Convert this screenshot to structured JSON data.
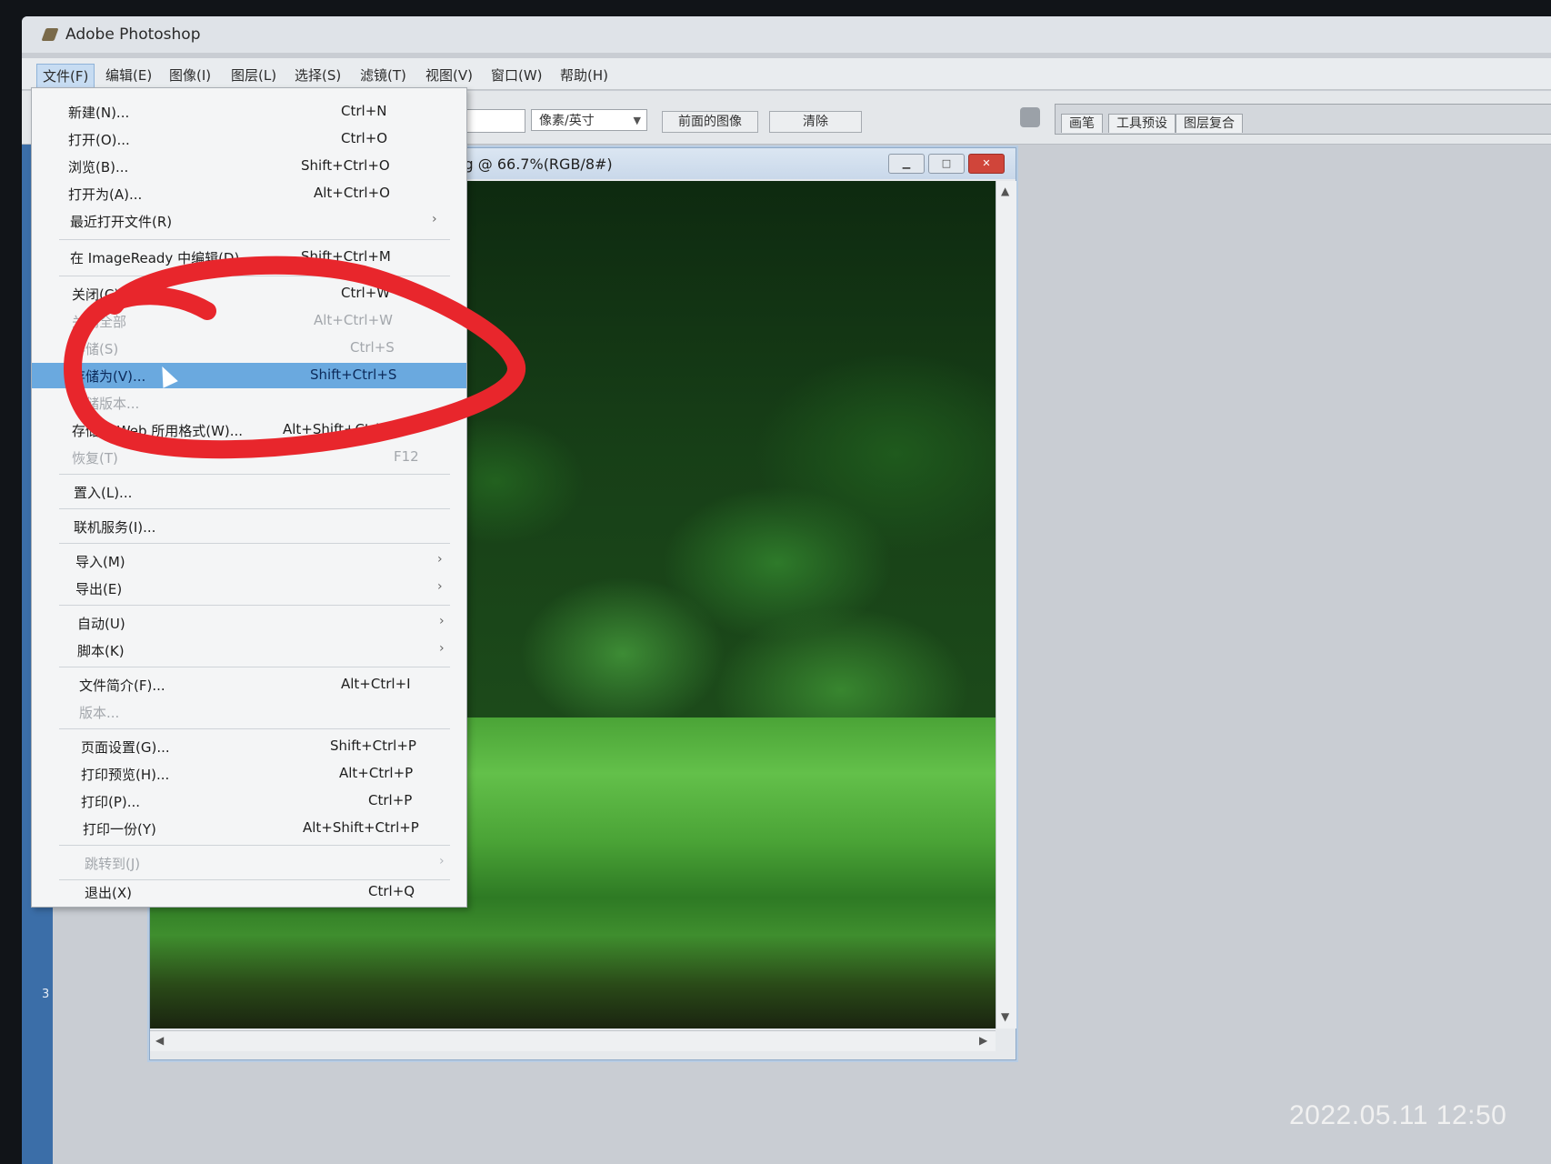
{
  "app": {
    "title": "Adobe Photoshop"
  },
  "menubar": {
    "items": [
      {
        "label": "文件(F)"
      },
      {
        "label": "编辑(E)"
      },
      {
        "label": "图像(I)"
      },
      {
        "label": "图层(L)"
      },
      {
        "label": "选择(S)"
      },
      {
        "label": "滤镜(T)"
      },
      {
        "label": "视图(V)"
      },
      {
        "label": "窗口(W)"
      },
      {
        "label": "帮助(H)"
      }
    ]
  },
  "options_bar": {
    "unit_select": "像素/英寸",
    "front_image_button": "前面的图像",
    "clear_button": "清除",
    "palette_tabs": [
      "画笔",
      "工具预设",
      "图层复合"
    ]
  },
  "document": {
    "title": ".jpeg @ 66.7%(RGB/8#)"
  },
  "file_menu": {
    "items": [
      {
        "label": "新建(N)...",
        "shortcut": "Ctrl+N"
      },
      {
        "label": "打开(O)...",
        "shortcut": "Ctrl+O"
      },
      {
        "label": "浏览(B)...",
        "shortcut": "Shift+Ctrl+O"
      },
      {
        "label": "打开为(A)...",
        "shortcut": "Alt+Ctrl+O"
      },
      {
        "label": "最近打开文件(R)",
        "shortcut": ""
      },
      {
        "label": "在 ImageReady 中编辑(D)",
        "shortcut": "Shift+Ctrl+M"
      },
      {
        "label": "关闭(C)",
        "shortcut": "Ctrl+W"
      },
      {
        "label": "关闭全部",
        "shortcut": "Alt+Ctrl+W"
      },
      {
        "label": "存储(S)",
        "shortcut": "Ctrl+S"
      },
      {
        "label": "存储为(V)...",
        "shortcut": "Shift+Ctrl+S"
      },
      {
        "label": "存储版本...",
        "shortcut": ""
      },
      {
        "label": "存储为 Web 所用格式(W)...",
        "shortcut": "Alt+Shift+Ctrl+S"
      },
      {
        "label": "恢复(T)",
        "shortcut": "F12"
      },
      {
        "label": "置入(L)...",
        "shortcut": ""
      },
      {
        "label": "联机服务(I)...",
        "shortcut": ""
      },
      {
        "label": "导入(M)",
        "shortcut": ""
      },
      {
        "label": "导出(E)",
        "shortcut": ""
      },
      {
        "label": "自动(U)",
        "shortcut": ""
      },
      {
        "label": "脚本(K)",
        "shortcut": ""
      },
      {
        "label": "文件简介(F)...",
        "shortcut": "Alt+Ctrl+I"
      },
      {
        "label": "版本...",
        "shortcut": ""
      },
      {
        "label": "页面设置(G)...",
        "shortcut": "Shift+Ctrl+P"
      },
      {
        "label": "打印预览(H)...",
        "shortcut": "Alt+Ctrl+P"
      },
      {
        "label": "打印(P)...",
        "shortcut": "Ctrl+P"
      },
      {
        "label": "打印一份(Y)",
        "shortcut": "Alt+Shift+Ctrl+P"
      },
      {
        "label": "跳转到(J)",
        "shortcut": ""
      },
      {
        "label": "退出(X)",
        "shortcut": "Ctrl+Q"
      }
    ]
  },
  "photo_timestamp": "2022.05.11 12:50",
  "colors": {
    "menu_highlight": "#6aa9df",
    "annotation_red": "#e8262c"
  }
}
